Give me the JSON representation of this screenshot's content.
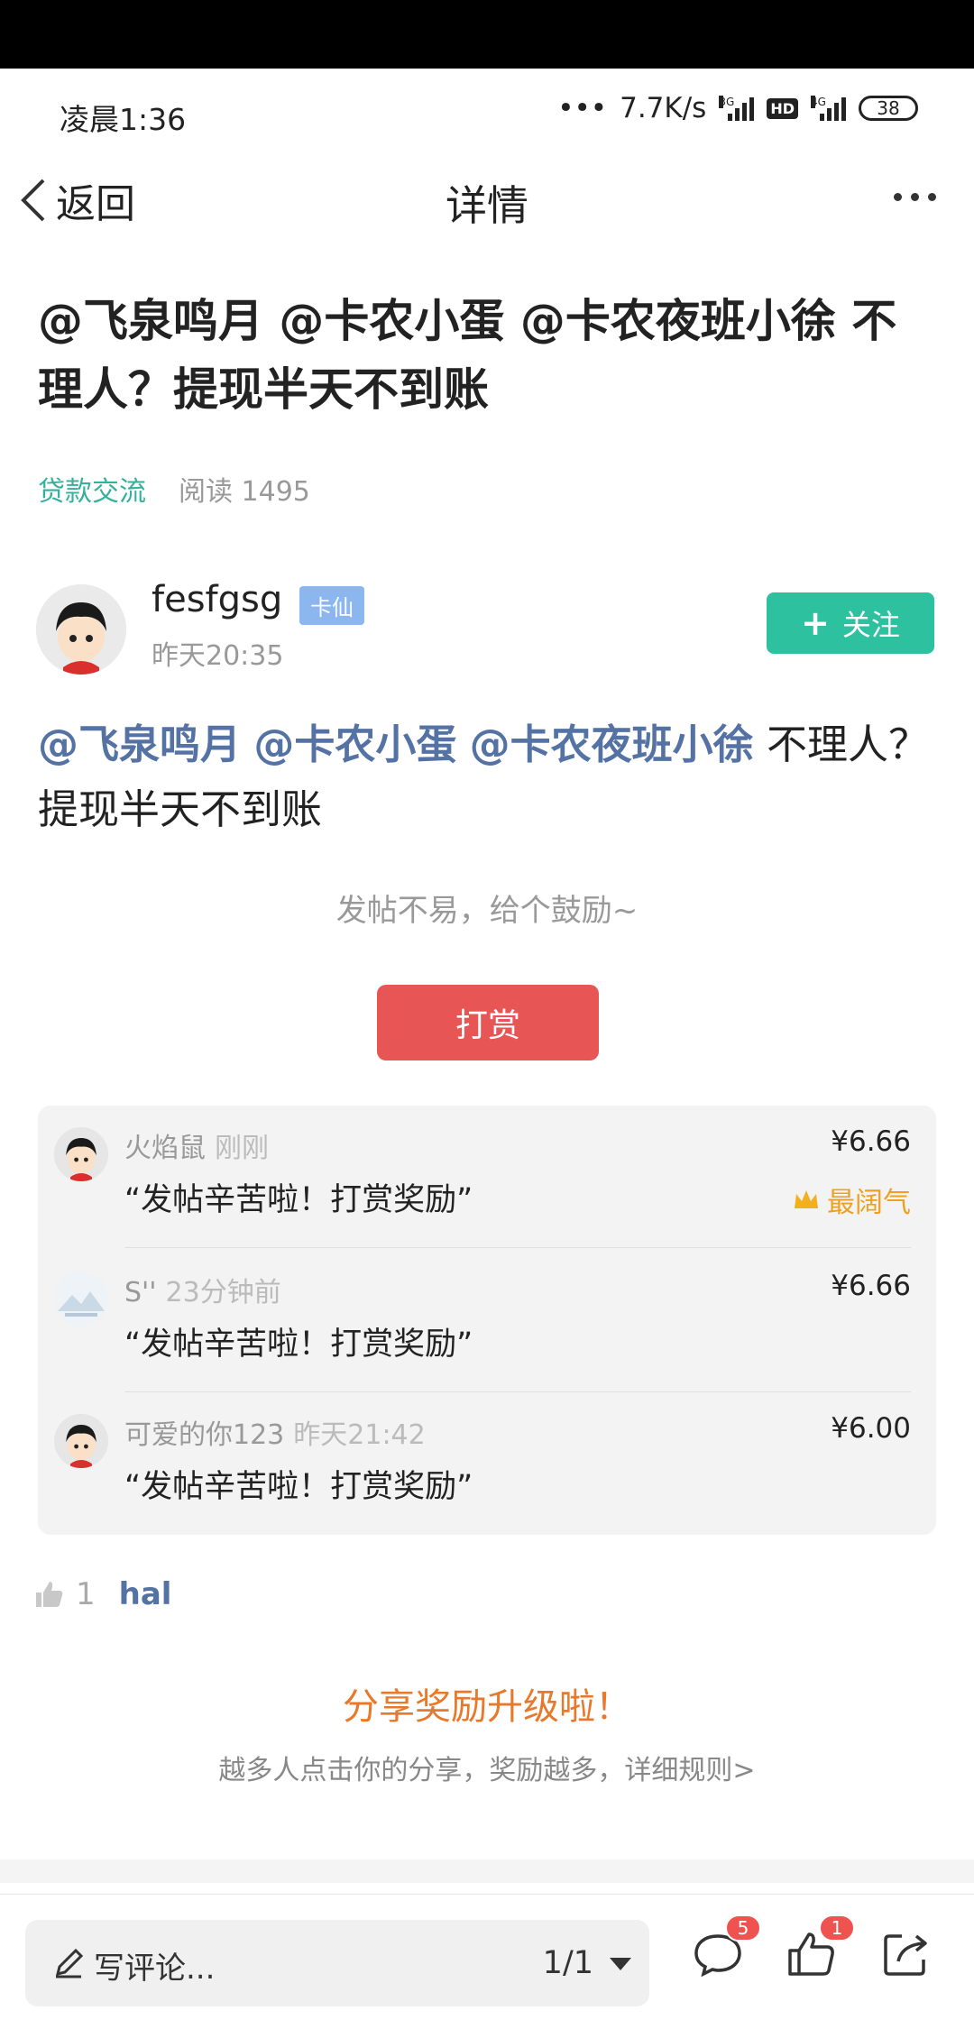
{
  "status_bar": {
    "time": "凌晨1:36",
    "speed": "7.7K/s",
    "net1": "3G",
    "hd": "HD",
    "net2": "4G",
    "battery": "38"
  },
  "nav": {
    "back_label": "返回",
    "title": "详情"
  },
  "post": {
    "title": "@飞泉鸣月 @卡农小蛋 @卡农夜班小徐 不理人？提现半天不到账",
    "category": "贷款交流",
    "read_count": "阅读 1495",
    "author": {
      "name": "fesfgsg",
      "badge": "卡仙",
      "time": "昨天20:35"
    },
    "follow_label": "关注",
    "mentions": [
      "@飞泉鸣月",
      "@卡农小蛋",
      "@卡农夜班小徐"
    ],
    "body_text": "不理人？提现半天不到账"
  },
  "reward": {
    "prompt": "发帖不易，给个鼓励~",
    "button_label": "打赏",
    "items": [
      {
        "name": "火焰鼠",
        "time": "刚刚",
        "message": "“发帖辛苦啦！打赏奖励”",
        "amount": "¥6.66",
        "tag": "最阔气"
      },
      {
        "name": "S''",
        "time": "23分钟前",
        "message": "“发帖辛苦啦！打赏奖励”",
        "amount": "¥6.66"
      },
      {
        "name": "可爱的你123",
        "time": "昨天21:42",
        "message": "“发帖辛苦啦！打赏奖励”",
        "amount": "¥6.00"
      }
    ]
  },
  "likes": {
    "count": "1",
    "names": "hal"
  },
  "share": {
    "title": "分享奖励升级啦！",
    "subtitle": "越多人点击你的分享，奖励越多，详细规则>"
  },
  "bottom": {
    "comment_placeholder": "写评论...",
    "page": "1/1",
    "comment_count": "5",
    "like_count": "1"
  },
  "icons": [
    "back-chevron-icon",
    "more-icon",
    "plus-icon",
    "crown-icon",
    "thumb-up-icon",
    "pen-icon",
    "comment-icon",
    "like-icon",
    "share-icon"
  ],
  "colors": {
    "accent_green": "#2ec1a0",
    "reward_red": "#e75555",
    "mention_blue": "#5472a4",
    "share_orange": "#e8782a"
  }
}
